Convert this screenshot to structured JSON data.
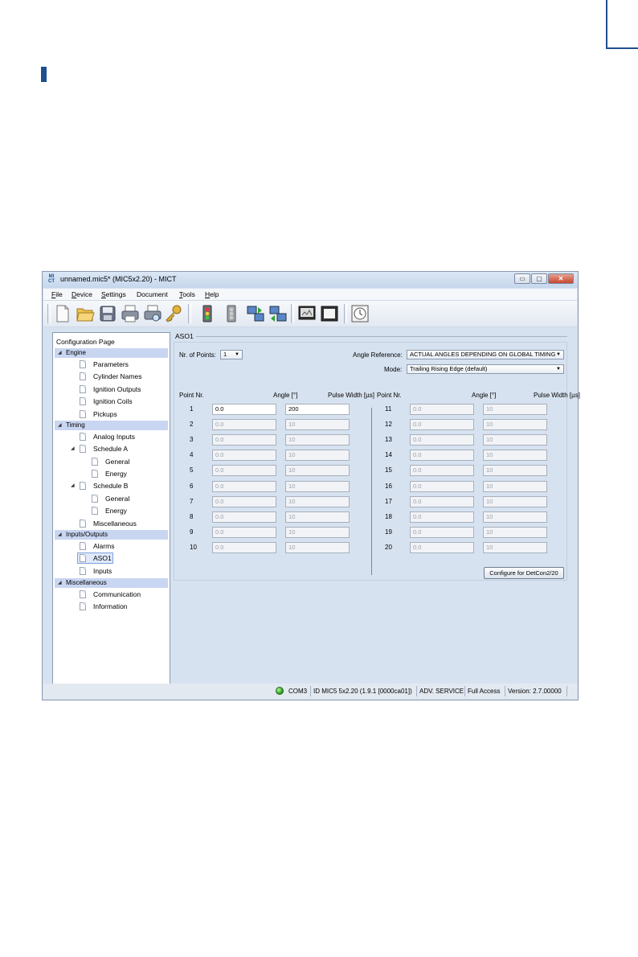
{
  "window": {
    "app_icon_text": [
      "MI",
      "CT"
    ],
    "title": "unnamed.mic5* (MIC5x2.20) - MICT",
    "buttons": {
      "minimize": "▭",
      "maximize": "▢",
      "close": "✕"
    }
  },
  "menu": [
    {
      "accel": "F",
      "rest": "ile"
    },
    {
      "accel": "D",
      "rest": "evice"
    },
    {
      "accel": "S",
      "rest": "ettings"
    },
    {
      "accel": "",
      "rest": "Document"
    },
    {
      "accel": "T",
      "rest": "ools"
    },
    {
      "accel": "H",
      "rest": "elp"
    }
  ],
  "toolbar": {
    "icons": [
      "new-document-icon",
      "open-folder-icon",
      "save-icon",
      "print-icon",
      "print-preview-icon",
      "key-icon",
      "device-on-icon",
      "device-off-icon",
      "upload-icon",
      "download-icon",
      "monitor-icon",
      "window-icon",
      "clock-icon"
    ]
  },
  "sidebar": {
    "title": "Configuration Page",
    "categories": {
      "engine": "Engine",
      "timing": "Timing",
      "inputs_outputs": "Inputs/Outputs",
      "misc": "Miscellaneous"
    },
    "items": {
      "parameters": "Parameters",
      "cylinder_names": "Cylinder Names",
      "ignition_outputs": "Ignition Outputs",
      "ignition_coils": "Ignition Coils",
      "pickups": "Pickups",
      "analog_inputs": "Analog Inputs",
      "schedule_a": "Schedule A",
      "schedule_a_general": "General",
      "schedule_a_energy": "Energy",
      "schedule_b": "Schedule B",
      "schedule_b_general": "General",
      "schedule_b_energy": "Energy",
      "timing_misc": "Miscellaneous",
      "alarms": "Alarms",
      "aso1": "ASO1",
      "inputs": "Inputs",
      "communication": "Communication",
      "information": "Information"
    }
  },
  "aso": {
    "group_title": "ASO1",
    "nr_points_label": "Nr. of Points:",
    "nr_points_value": "1",
    "angle_ref_label": "Angle Reference:",
    "angle_ref_value": "ACTUAL ANGLES DEPENDING ON GLOBAL TIMING",
    "mode_label": "Mode:",
    "mode_value": "Trailing Rising Edge (default)",
    "headers": {
      "point": "Point Nr.",
      "angle": "Angle [°]",
      "pulse": "Pulse Width [µs]"
    },
    "left_points": [
      {
        "nr": "1",
        "angle": "0.0",
        "pulse": "200"
      },
      {
        "nr": "2",
        "angle": "0.0",
        "pulse": "10"
      },
      {
        "nr": "3",
        "angle": "0.0",
        "pulse": "10"
      },
      {
        "nr": "4",
        "angle": "0.0",
        "pulse": "10"
      },
      {
        "nr": "5",
        "angle": "0.0",
        "pulse": "10"
      },
      {
        "nr": "6",
        "angle": "0.0",
        "pulse": "10"
      },
      {
        "nr": "7",
        "angle": "0.0",
        "pulse": "10"
      },
      {
        "nr": "8",
        "angle": "0.0",
        "pulse": "10"
      },
      {
        "nr": "9",
        "angle": "0.0",
        "pulse": "10"
      },
      {
        "nr": "10",
        "angle": "0.0",
        "pulse": "10"
      }
    ],
    "right_points": [
      {
        "nr": "11",
        "angle": "0.0",
        "pulse": "10"
      },
      {
        "nr": "12",
        "angle": "0.0",
        "pulse": "10"
      },
      {
        "nr": "13",
        "angle": "0.0",
        "pulse": "10"
      },
      {
        "nr": "14",
        "angle": "0.0",
        "pulse": "10"
      },
      {
        "nr": "15",
        "angle": "0.0",
        "pulse": "10"
      },
      {
        "nr": "16",
        "angle": "0.0",
        "pulse": "10"
      },
      {
        "nr": "17",
        "angle": "0.0",
        "pulse": "10"
      },
      {
        "nr": "18",
        "angle": "0.0",
        "pulse": "10"
      },
      {
        "nr": "19",
        "angle": "0.0",
        "pulse": "10"
      },
      {
        "nr": "20",
        "angle": "0.0",
        "pulse": "10"
      }
    ],
    "configure_button": "Configure for DetCon2/20"
  },
  "status": {
    "port": "COM3",
    "device_id": "ID MIC5 5x2.20 (1.9.1 [0000ca01])",
    "mode": "ADV. SERVICE",
    "access": "Full Access",
    "version": "Version: 2.7.00000"
  }
}
